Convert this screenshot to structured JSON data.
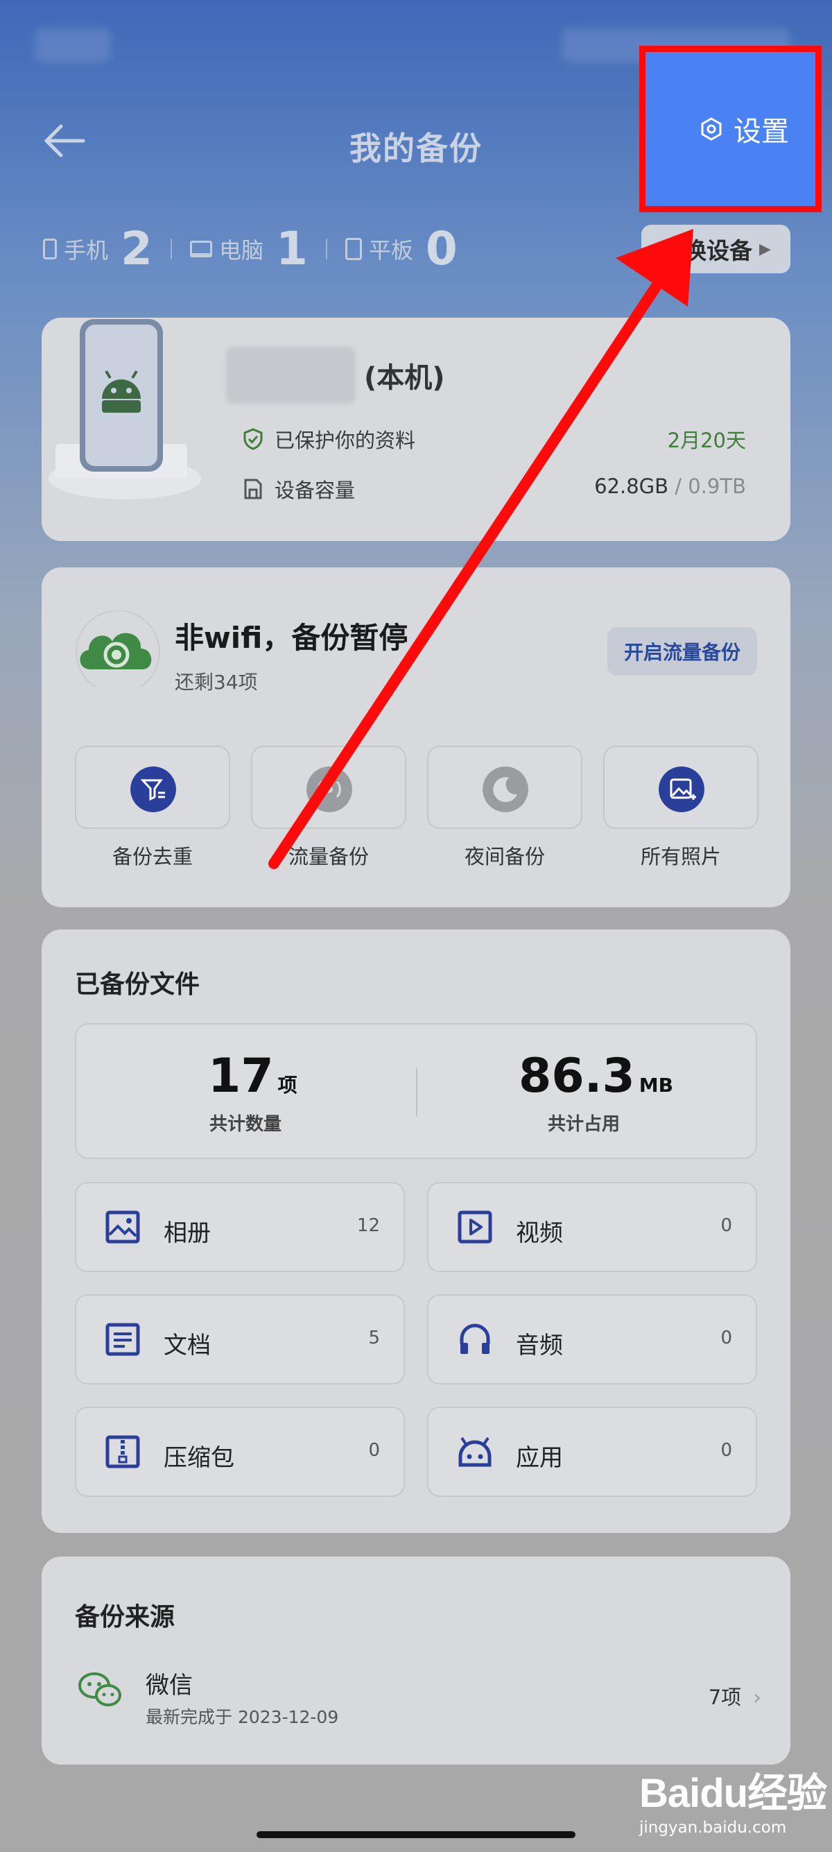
{
  "header": {
    "title": "我的备份",
    "settings_label": "设置"
  },
  "device_counts": [
    {
      "label": "手机",
      "count": "2"
    },
    {
      "label": "电脑",
      "count": "1"
    },
    {
      "label": "平板",
      "count": "0"
    }
  ],
  "switch_device_label": "切换设备",
  "device_card": {
    "local_tag": "(本机)",
    "protect_text": "已保护你的资料",
    "protect_days": "2月20天",
    "capacity_label": "设备容量",
    "capacity_used": "62.8GB",
    "capacity_sep": " / ",
    "capacity_total": "0.9TB"
  },
  "backup_status": {
    "title": "非wifi，备份暂停",
    "subtitle": "还剩34项",
    "action_label": "开启流量备份"
  },
  "features": [
    {
      "label": "备份去重",
      "icon": "filter-icon"
    },
    {
      "label": "流量备份",
      "icon": "signal-icon"
    },
    {
      "label": "夜间备份",
      "icon": "moon-icon"
    },
    {
      "label": "所有照片",
      "icon": "photo-icon"
    }
  ],
  "files": {
    "title": "已备份文件",
    "total_count": "17",
    "total_count_unit": "项",
    "total_count_label": "共计数量",
    "total_size": "86.3",
    "total_size_unit": "MB",
    "total_size_label": "共计占用",
    "items": [
      {
        "label": "相册",
        "count": "12",
        "icon": "album-icon"
      },
      {
        "label": "视频",
        "count": "0",
        "icon": "video-icon"
      },
      {
        "label": "文档",
        "count": "5",
        "icon": "document-icon"
      },
      {
        "label": "音频",
        "count": "0",
        "icon": "headphones-icon"
      },
      {
        "label": "压缩包",
        "count": "0",
        "icon": "archive-icon"
      },
      {
        "label": "应用",
        "count": "0",
        "icon": "android-icon"
      }
    ]
  },
  "sources": {
    "title": "备份来源",
    "items": [
      {
        "name": "微信",
        "date": "最新完成于 2023-12-09",
        "count": "7项"
      }
    ]
  },
  "watermark": {
    "logo": "Baidu经验",
    "url": "jingyan.baidu.com"
  },
  "colors": {
    "settings_highlight": "#4a82f3",
    "annotation_red": "#ff0a0a",
    "protect_green": "#3f7d3a",
    "icon_blue": "#2a3f9a"
  }
}
